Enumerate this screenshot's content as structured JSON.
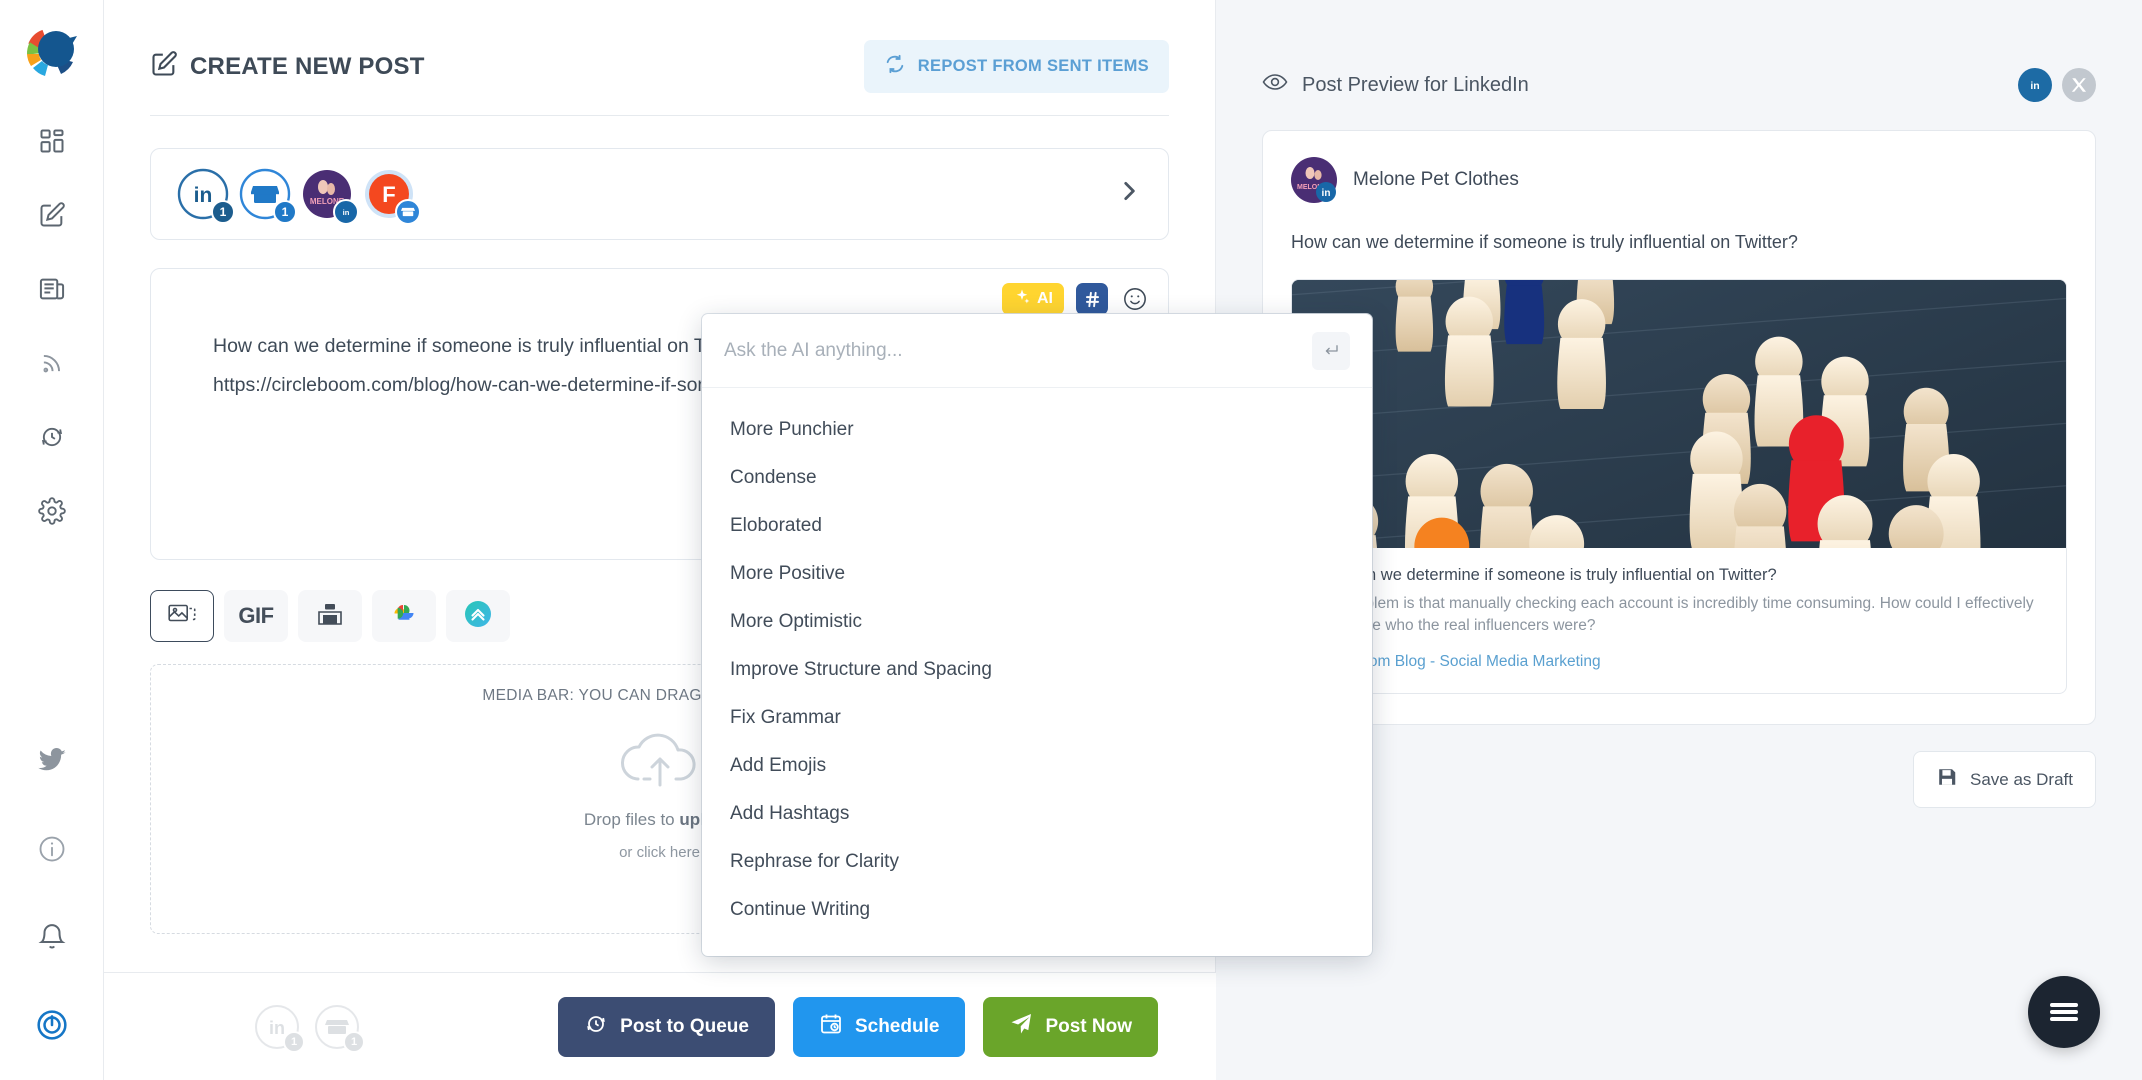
{
  "sidebar": {
    "logo_name": "circleboom-logo",
    "top_items": [
      {
        "name": "dashboard",
        "icon": "grid-icon"
      },
      {
        "name": "create-post",
        "icon": "compose-icon"
      },
      {
        "name": "articles",
        "icon": "news-icon"
      },
      {
        "name": "rss",
        "icon": "rss-icon"
      },
      {
        "name": "queue",
        "icon": "clock-refresh-icon"
      },
      {
        "name": "settings",
        "icon": "gear-icon"
      }
    ],
    "bottom_items": [
      {
        "name": "twitter",
        "icon": "twitter-bird-icon"
      },
      {
        "name": "info",
        "icon": "info-circle-icon"
      },
      {
        "name": "notifications",
        "icon": "bell-icon"
      },
      {
        "name": "logout",
        "icon": "power-icon"
      }
    ]
  },
  "composer": {
    "title": "CREATE NEW POST",
    "title_icon": "compose-icon",
    "repost_label": "REPOST FROM SENT ITEMS",
    "repost_icon": "refresh-icon",
    "accounts": [
      {
        "name": "linkedin-account",
        "type": "linkedin",
        "badge": "1"
      },
      {
        "name": "shop-account",
        "type": "shop",
        "badge": "1"
      },
      {
        "name": "melone-page",
        "type": "melone",
        "badge": ""
      },
      {
        "name": "facebook-page",
        "type": "facebook",
        "badge": ""
      }
    ],
    "expand_icon": "chevron-right-icon",
    "editor": {
      "text": "How can we determine if someone is truly influential on Twitter?\nhttps://circleboom.com/blog/how-can-we-determine-if-someone-is-truly-influential-on-twitter/",
      "ai_label": "AI",
      "ai_icon": "sparkle-icon",
      "hashtag_icon": "hashtag-icon",
      "emoji_icon": "smiley-icon"
    },
    "media_tools": [
      {
        "name": "image-tool",
        "icon": "image-icon",
        "label": "",
        "active": true
      },
      {
        "name": "gif-tool",
        "icon": "gif-icon",
        "label": "GIF",
        "active": false
      },
      {
        "name": "unsplash-tool",
        "icon": "unsplash-icon",
        "label": "",
        "active": false
      },
      {
        "name": "google-photos-tool",
        "icon": "google-photos-icon",
        "label": "",
        "active": false
      },
      {
        "name": "canva-tool",
        "icon": "canva-arrow-icon",
        "label": "",
        "active": false
      }
    ],
    "dropzone": {
      "label": "MEDIA BAR: YOU CAN DRAG-N-DROP IMAGES",
      "line1_prefix": "Drop files to ",
      "line1_bold": "upload",
      "line2": "or click here",
      "icon": "cloud-upload-icon"
    },
    "footer_accounts": [
      {
        "name": "linkedin-account-mini",
        "type": "linkedin",
        "badge": "1"
      },
      {
        "name": "shop-account-mini",
        "type": "shop",
        "badge": "1"
      }
    ],
    "buttons": [
      {
        "name": "post-to-queue-button",
        "label": "Post to Queue",
        "icon": "clock-refresh-icon",
        "color": "#3c4d73"
      },
      {
        "name": "schedule-button",
        "label": "Schedule",
        "icon": "calendar-clock-icon",
        "color": "#2196ee"
      },
      {
        "name": "post-now-button",
        "label": "Post Now",
        "icon": "paper-plane-icon",
        "color": "#6aa52a"
      }
    ]
  },
  "ai_popup": {
    "placeholder": "Ask the AI anything...",
    "value": "",
    "enter_icon": "enter-key-icon",
    "options": [
      "More Punchier",
      "Condense",
      "Eloborated",
      "More Positive",
      "More Optimistic",
      "Improve Structure and Spacing",
      "Fix Grammar",
      "Add Emojis",
      "Add Hashtags",
      "Rephrase for Clarity",
      "Continue Writing"
    ]
  },
  "preview": {
    "title": "Post Preview for LinkedIn",
    "title_icon": "eye-icon",
    "networks": [
      {
        "name": "linkedin-toggle",
        "icon": "linkedin-icon",
        "active": true
      },
      {
        "name": "x-toggle",
        "icon": "x-icon",
        "active": false
      }
    ],
    "author": "Melone Pet Clothes",
    "avatar_name": "melone-avatar",
    "post_text": "How can we determine if someone is truly influential on Twitter?",
    "link_card": {
      "image_name": "wooden-peg-figures-image",
      "headline": "How can we determine if someone is truly influential on Twitter?",
      "description": "The problem is that manually checking each account is incredibly time consuming. How could I effectively determine who the real influencers were?",
      "source": "Circleboom Blog - Social Media Marketing"
    },
    "save_draft_label": "Save as Draft",
    "save_draft_icon": "floppy-disk-icon",
    "fab_icon": "hamburger-menu-icon"
  },
  "colors": {
    "accent_blue": "#2196ee",
    "navy": "#3c4d73",
    "green": "#6aa52a",
    "ai_yellow": "#ffd530",
    "hashtag_blue": "#30599c",
    "panel_bg": "#f4f6f9"
  }
}
